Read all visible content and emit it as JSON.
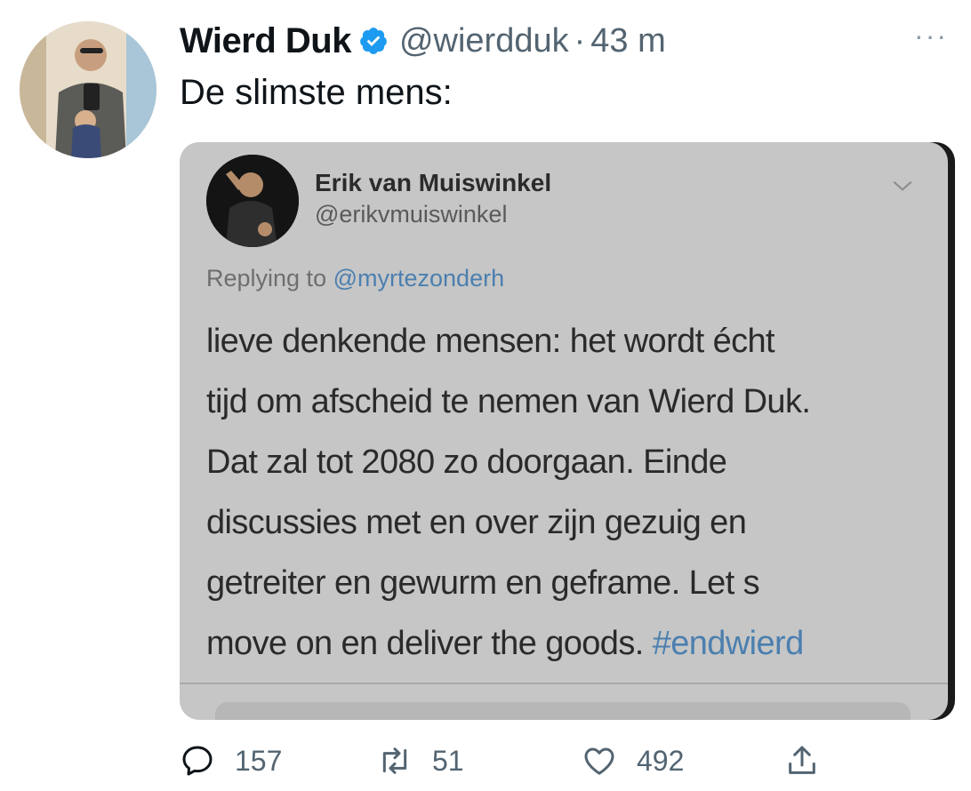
{
  "tweet": {
    "author_name": "Wierd Duk",
    "handle": "@wierdduk",
    "separator": "·",
    "time": "43 m",
    "text": "De slimste mens:",
    "more_label": "···"
  },
  "quoted": {
    "author_name": "Erik van Muiswinkel",
    "handle": "@erikvmuiswinkel",
    "replying_prefix": "Replying to",
    "replying_to": "@myrtezonderh",
    "lines": [
      "lieve denkende mensen: het wordt écht",
      "tijd om afscheid te nemen van Wierd Duk.",
      "Dat zal tot 2080 zo doorgaan. Einde",
      "discussies met en over zijn gezuig en",
      "getreiter en gewurm en geframe. Let s"
    ],
    "last_line_text": "move on en deliver the goods.",
    "hashtag": "#endwierd"
  },
  "actions": {
    "replies": "157",
    "retweets": "51",
    "likes": "492"
  },
  "colors": {
    "verified": "#1d9bf0",
    "link": "#4b7faf",
    "secondary_text": "#536471"
  },
  "icons": [
    "verified-icon",
    "more-icon",
    "chevron-down-icon",
    "reply-icon",
    "retweet-icon",
    "like-icon",
    "share-icon"
  ]
}
